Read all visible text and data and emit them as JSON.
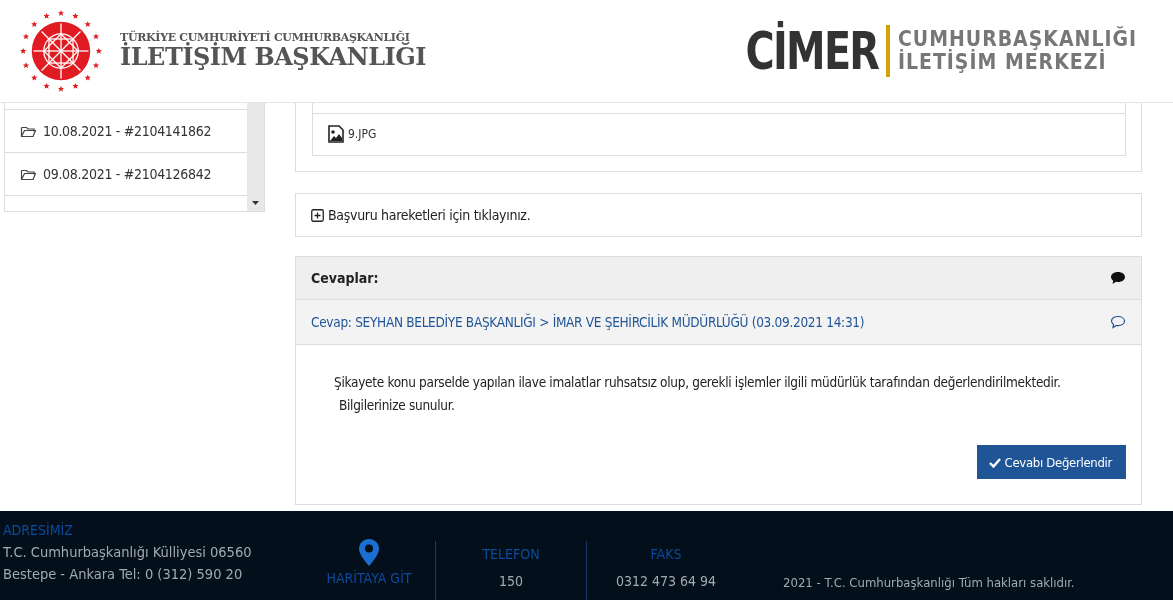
{
  "header": {
    "left_logo": {
      "line1": "TÜRKİYE CUMHURİYETİ CUMHURBAŞKANLIĞI",
      "line2": "İLETİŞİM BAŞKANLIĞI"
    },
    "right_logo": {
      "wordmark": "CİMER",
      "line1": "CUMHURBAŞKANLIĞI",
      "line2": "İLETİŞİM MERKEZİ"
    }
  },
  "sidebar": {
    "items": [
      "10.08.2021 - #2104141862",
      "09.08.2021 - #2104126842"
    ]
  },
  "attachments": [
    {
      "name": "9.JPG"
    }
  ],
  "history_toggle": {
    "label": "Başvuru hareketleri için tıklayınız.",
    "expanded": false
  },
  "answers": {
    "title": "Cevaplar:",
    "items": [
      {
        "heading": "Cevap: SEYHAN BELEDİYE BAŞKANLIĞI > İMAR VE ŞEHİRCİLİK MÜDÜRLÜĞÜ (03.09.2021 14:31)",
        "paragraphs": [
          "Şikayete konu parselde yapılan ilave imalatlar ruhsatsız olup, gerekli işlemler ilgili müdürlük tarafından değerlendirilmektedir.",
          "Bilgilerinize sunulur."
        ],
        "button": "Cevabı Değerlendir"
      }
    ]
  },
  "footer": {
    "address_title": "ADRESİMİZ",
    "address_lines": [
      "T.C. Cumhurbaşkanlığı Külliyesi 06560",
      "Bestepe - Ankara Tel: 0 (312) 590 20"
    ],
    "map_link": "HARİTAYA GİT",
    "phone": {
      "title": "TELEFON",
      "value": "150"
    },
    "fax": {
      "title": "FAKS",
      "value": "0312 473 64 94"
    },
    "copyright": "2021 - T.C. Cumhurbaşkanlığı Tüm hakları saklıdır."
  }
}
